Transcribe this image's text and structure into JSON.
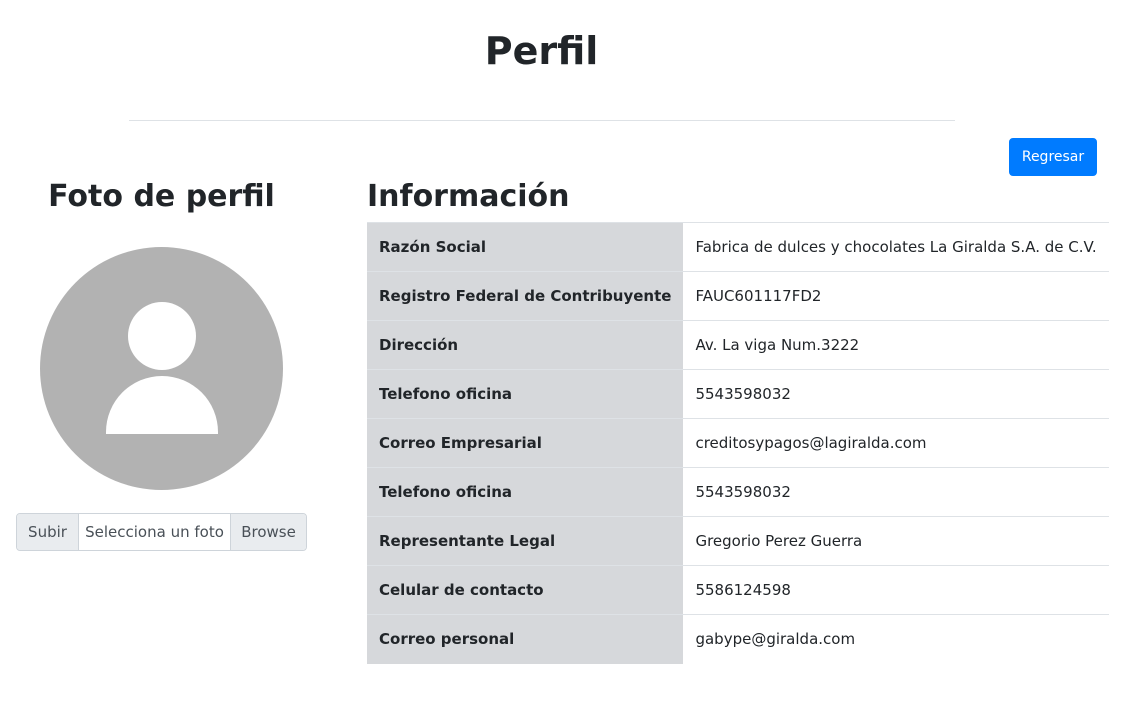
{
  "header": {
    "title": "Perfil"
  },
  "toolbar": {
    "back_label": "Regresar"
  },
  "photo": {
    "title": "Foto de perfil",
    "upload_label": "Subir",
    "file_placeholder": "Selecciona un foto",
    "browse_label": "Browse"
  },
  "info": {
    "title": "Información",
    "rows": [
      {
        "label": "Razón Social",
        "value": "Fabrica de dulces y chocolates La Giralda S.A. de C.V."
      },
      {
        "label": "Registro Federal de Contribuyente",
        "value": "FAUC601117FD2"
      },
      {
        "label": "Dirección",
        "value": "Av. La viga Num.3222"
      },
      {
        "label": "Telefono oficina",
        "value": "5543598032"
      },
      {
        "label": "Correo Empresarial",
        "value": "creditosypagos@lagiralda.com"
      },
      {
        "label": "Telefono oficina",
        "value": "5543598032"
      },
      {
        "label": "Representante Legal",
        "value": "Gregorio Perez Guerra"
      },
      {
        "label": "Celular de contacto",
        "value": "5586124598"
      },
      {
        "label": "Correo personal",
        "value": "gabype@giralda.com"
      }
    ]
  },
  "colors": {
    "primary": "#007bff",
    "label_bg": "#d6d8db",
    "avatar": "#b2b2b2"
  },
  "icons": {
    "avatar": "user-placeholder-icon"
  }
}
